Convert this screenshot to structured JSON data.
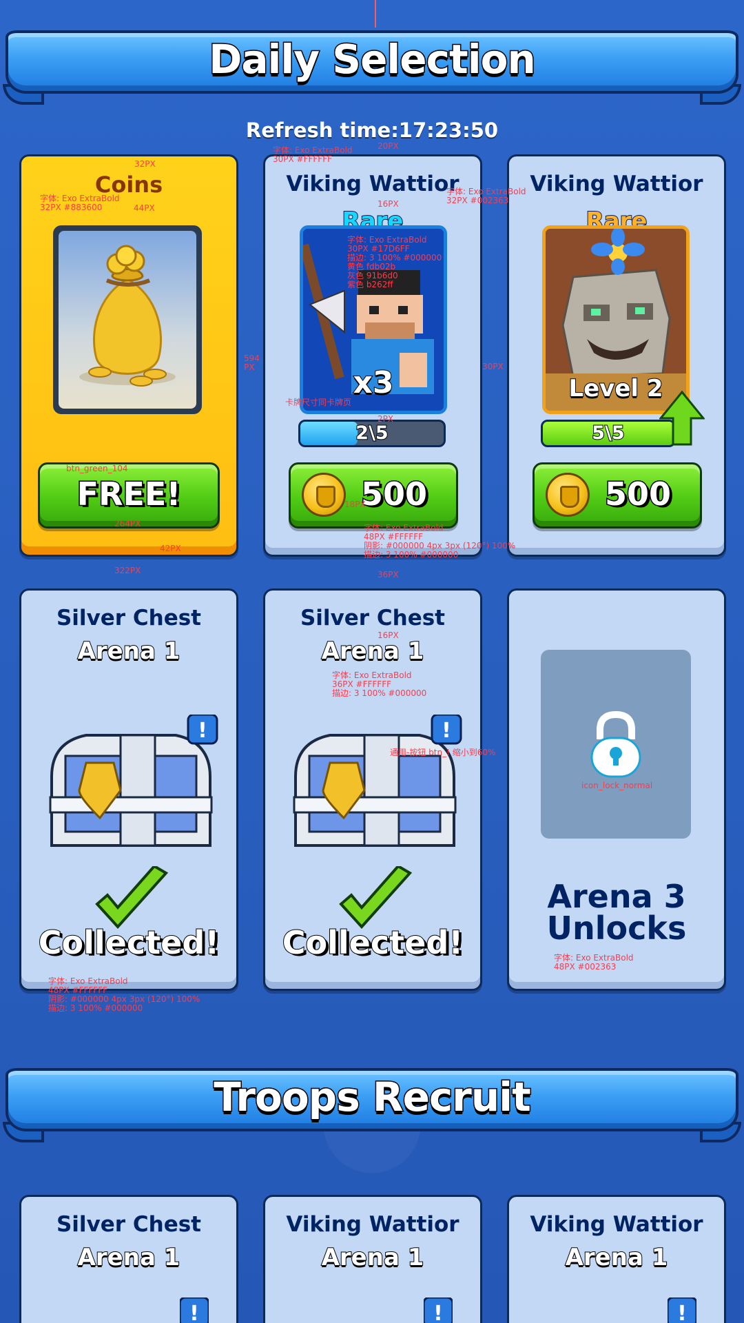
{
  "sections": {
    "daily": {
      "title": "Daily Selection",
      "refresh_label": "Refresh time:17:23:50"
    },
    "troops": {
      "title": "Troops Recruit"
    }
  },
  "daily_cards": {
    "coins": {
      "title": "Coins",
      "button": "FREE!"
    },
    "viking1": {
      "title": "Viking Wattior",
      "rarity": "Rare",
      "count": "x3",
      "progress_text": "2\\5",
      "progress": 0.4,
      "price": "500"
    },
    "viking2": {
      "title": "Viking Wattior",
      "rarity": "Rare",
      "level": "Level 2",
      "progress_text": "5\\5",
      "progress": 1.0,
      "price": "500"
    },
    "chest1": {
      "title": "Silver Chest",
      "subtitle": "Arena 1",
      "status": "Collected!"
    },
    "chest2": {
      "title": "Silver Chest",
      "subtitle": "Arena 1",
      "status": "Collected!"
    },
    "locked": {
      "line1": "Arena 3",
      "line2": "Unlocks"
    }
  },
  "troop_cards": [
    {
      "title": "Silver Chest",
      "subtitle": "Arena 1"
    },
    {
      "title": "Viking Wattior",
      "subtitle": "Arena 1"
    },
    {
      "title": "Viking Wattior",
      "subtitle": "Arena 1"
    }
  ],
  "annotations": {
    "a1": "32PX",
    "a2": "字体: Exo ExtraBold\n32PX #883600",
    "a3": "44PX",
    "a4": "字体: Exo ExtraBold\n30PX #FFFFFF",
    "a5": "20PX",
    "a6": "字体: Exo ExtraBold\n32PX #002363",
    "a7": "16PX",
    "a8": "字体: Exo ExtraBold\n30PX #17D6FF\n描边: 3 100% #000000\n黄色 fdb02b\n灰色 91b6d0\n紫色 b262ff",
    "a9": "594\nPX",
    "a10": "30PX",
    "a11": "卡牌尺寸同卡牌页",
    "a12": "2PX",
    "a13": "btn_green_104",
    "a14": "18PX",
    "a15": "264PX",
    "a16": "字体: Exo ExtraBold\n48PX #FFFFFF\n阴影: #000000 4px 3px (120°) 100%\n描边: 3 100% #000000",
    "a17": "42PX",
    "a18": "322PX",
    "a19": "36PX",
    "a20": "16PX",
    "a21": "字体: Exo ExtraBold\n36PX #FFFFFF\n描边: 3 100% #000000",
    "a22": "通用-按钮 btn_! 缩小到60%",
    "a23": "icon_lock_normal",
    "a24": "字体: Exo ExtraBold\n48PX #FFFFFF\n阴影: #000000 4px 3px (120°) 100%\n描边: 3 100% #000000",
    "a25": "字体: Exo ExtraBold\n48PX #002363"
  },
  "colors": {
    "gold_title": "#883600",
    "navy_title": "#002363",
    "rare_blue": "#17D6FF",
    "rare_orange": "#fdb02b"
  }
}
